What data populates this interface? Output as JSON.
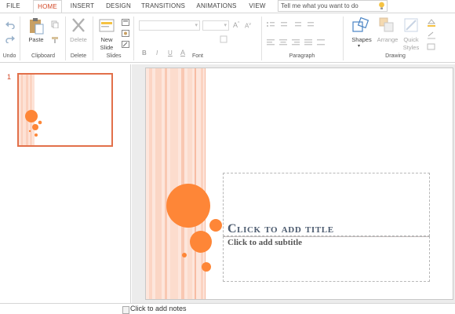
{
  "tabs": [
    "FILE",
    "HOME",
    "INSERT",
    "DESIGN",
    "TRANSITIONS",
    "ANIMATIONS",
    "VIEW"
  ],
  "active_tab": "HOME",
  "tell_me": {
    "placeholder": "Tell me what you want to do"
  },
  "ribbon": {
    "groups": {
      "undo": "Undo",
      "clipboard": "Clipboard",
      "delete": "Delete",
      "slides": "Slides",
      "font": "Font",
      "paragraph": "Paragraph",
      "drawing": "Drawing"
    },
    "buttons": {
      "paste": "Paste",
      "delete": "Delete",
      "new_slide_1": "New",
      "new_slide_2": "Slide",
      "shapes": "Shapes",
      "arrange": "Arrange",
      "quick_styles_1": "Quick",
      "quick_styles_2": "Styles"
    },
    "font_buttons": [
      "B",
      "I",
      "U",
      "A"
    ]
  },
  "thumbnail": {
    "number": "1"
  },
  "slide": {
    "title_placeholder": "Click to add title",
    "subtitle_placeholder": "Click to add subtitle"
  },
  "notes": {
    "placeholder": "Click to add notes"
  },
  "colors": {
    "accent": "#d24726",
    "orange": "#fe8637",
    "stripe": "#fde2d6"
  }
}
